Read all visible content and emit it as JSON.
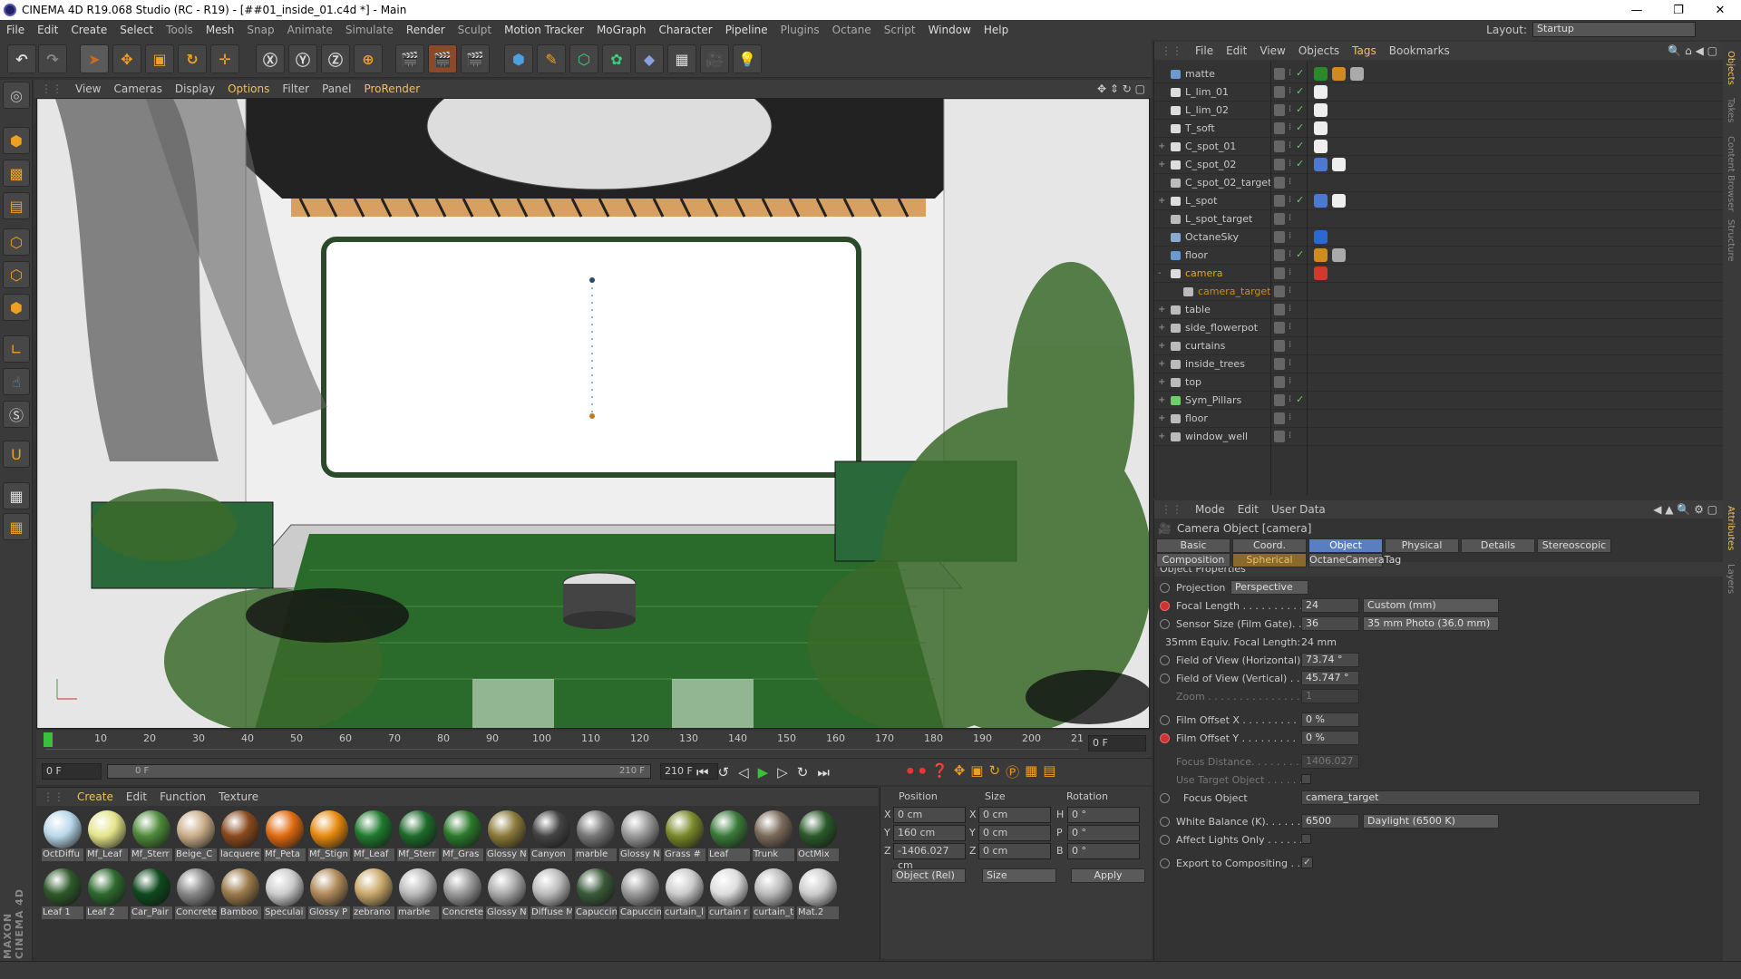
{
  "window": {
    "title": "CINEMA 4D R19.068 Studio (RC - R19) - [##01_inside_01.c4d *] - Main"
  },
  "menu": [
    "File",
    "Edit",
    "Create",
    "Select",
    "Tools",
    "Mesh",
    "Snap",
    "Animate",
    "Simulate",
    "Render",
    "Sculpt",
    "Motion Tracker",
    "MoGraph",
    "Character",
    "Pipeline",
    "Plugins",
    "Octane",
    "Script",
    "Window",
    "Help"
  ],
  "layout": {
    "label": "Layout:",
    "value": "Startup"
  },
  "viewport": {
    "menu": [
      "View",
      "Cameras",
      "Display",
      "Options",
      "Filter",
      "Panel",
      "ProRender"
    ]
  },
  "timeline": {
    "ticks": [
      "0",
      "10",
      "20",
      "30",
      "40",
      "50",
      "60",
      "70",
      "80",
      "90",
      "100",
      "110",
      "120",
      "130",
      "140",
      "150",
      "160",
      "170",
      "180",
      "190",
      "200",
      "21"
    ],
    "current_frame": "0 F",
    "start_field": "0 F",
    "slider_start": "0 F",
    "slider_end": "210 F",
    "end_field": "210 F"
  },
  "materials": {
    "menu": [
      "Create",
      "Edit",
      "Function",
      "Texture"
    ],
    "row1": [
      {
        "name": "OctDiffu",
        "color": "#b9d8ea"
      },
      {
        "name": "Mf_Leaf",
        "color": "#e4e48a"
      },
      {
        "name": "Mf_Sterr",
        "color": "#4e8a3a"
      },
      {
        "name": "Beige_C",
        "color": "#c9ad8a"
      },
      {
        "name": "lacquere",
        "color": "#8a4a1e"
      },
      {
        "name": "Mf_Peta",
        "color": "#e06a10"
      },
      {
        "name": "Mf_Stign",
        "color": "#e68a10"
      },
      {
        "name": "Mf_Leaf",
        "color": "#1f7a2e"
      },
      {
        "name": "Mf_Sterr",
        "color": "#1d6a2a"
      },
      {
        "name": "Mf_Gras",
        "color": "#2b7a2b"
      },
      {
        "name": "Glossy N",
        "color": "#8a7a3a"
      },
      {
        "name": "Canyon",
        "color": "#444"
      },
      {
        "name": "marble",
        "color": "#777"
      },
      {
        "name": "Glossy N",
        "color": "#999"
      },
      {
        "name": "Grass #",
        "color": "#7a8a2a"
      },
      {
        "name": "Leaf",
        "color": "#3a7a3a"
      },
      {
        "name": "Trunk",
        "color": "#7a6a5a"
      },
      {
        "name": "OctMix",
        "color": "#2a5a2a"
      }
    ],
    "row2": [
      {
        "name": "Leaf 1",
        "color": "#2e5a2a"
      },
      {
        "name": "Leaf 2",
        "color": "#2e6a2e"
      },
      {
        "name": "Car_Pair",
        "color": "#0e4a1e"
      },
      {
        "name": "Concrete",
        "color": "#888"
      },
      {
        "name": "Bamboo",
        "color": "#9a7a4a"
      },
      {
        "name": "Speculai",
        "color": "#ccc"
      },
      {
        "name": "Glossy P",
        "color": "#b08a5a"
      },
      {
        "name": "zebrano",
        "color": "#c9a86a"
      },
      {
        "name": "marble",
        "color": "#bbb"
      },
      {
        "name": "Concrete",
        "color": "#999"
      },
      {
        "name": "Glossy N",
        "color": "#aaa"
      },
      {
        "name": "Diffuse M",
        "color": "#bbb"
      },
      {
        "name": "Capuccin",
        "color": "#3a5a3a"
      },
      {
        "name": "Capuccin",
        "color": "#999"
      },
      {
        "name": "curtain_l",
        "color": "#ccc"
      },
      {
        "name": "curtain r",
        "color": "#ddd"
      },
      {
        "name": "curtain_t",
        "color": "#bbb"
      },
      {
        "name": "Mat.2",
        "color": "#ccc"
      }
    ]
  },
  "coords": {
    "headers": [
      "Position",
      "Size",
      "Rotation"
    ],
    "rows": [
      {
        "a": "X",
        "pos": "0 cm",
        "b": "X",
        "size": "0 cm",
        "c": "H",
        "rot": "0 °"
      },
      {
        "a": "Y",
        "pos": "160 cm",
        "b": "Y",
        "size": "0 cm",
        "c": "P",
        "rot": "0 °"
      },
      {
        "a": "Z",
        "pos": "-1406.027 cm",
        "b": "Z",
        "size": "0 cm",
        "c": "B",
        "rot": "0 °"
      }
    ],
    "mode": "Object (Rel)",
    "size_mode": "Size",
    "apply": "Apply"
  },
  "objects": {
    "menu": [
      "File",
      "Edit",
      "View",
      "Objects",
      "Tags",
      "Bookmarks"
    ],
    "items": [
      {
        "name": "matte",
        "expand": "",
        "icon": "#6a9ad0",
        "check": true,
        "tags": [
          "#2a8a2a",
          "#d08a20",
          "#aaa"
        ]
      },
      {
        "name": "L_lim_01",
        "expand": "",
        "icon": "#ddd",
        "check": true,
        "tags": [
          "#eee"
        ]
      },
      {
        "name": "L_lim_02",
        "expand": "",
        "icon": "#ddd",
        "check": true,
        "tags": [
          "#eee"
        ]
      },
      {
        "name": "T_soft",
        "expand": "",
        "icon": "#ddd",
        "check": true,
        "tags": [
          "#eee"
        ]
      },
      {
        "name": "C_spot_01",
        "expand": "+",
        "icon": "#ddd",
        "check": true,
        "tags": [
          "#eee"
        ]
      },
      {
        "name": "C_spot_02",
        "expand": "+",
        "icon": "#ddd",
        "check": true,
        "tags": [
          "#4a7ad0",
          "#eee"
        ]
      },
      {
        "name": "C_spot_02_target",
        "expand": "",
        "icon": "#bbb",
        "check": false,
        "tags": []
      },
      {
        "name": "L_spot",
        "expand": "+",
        "icon": "#ddd",
        "check": true,
        "tags": [
          "#4a7ad0",
          "#eee"
        ]
      },
      {
        "name": "L_spot_target",
        "expand": "",
        "icon": "#bbb",
        "check": false,
        "tags": []
      },
      {
        "name": "OctaneSky",
        "expand": "",
        "icon": "#8aaad0",
        "check": false,
        "tags": [
          "#2a6ad0"
        ]
      },
      {
        "name": "floor",
        "expand": "",
        "icon": "#6a9ad0",
        "check": true,
        "tags": [
          "#d08a20",
          "#aaa"
        ]
      },
      {
        "name": "camera",
        "expand": "-",
        "icon": "#ddd",
        "check": false,
        "selected": true,
        "tags": [
          "#d03a2a"
        ]
      },
      {
        "name": "camera_target",
        "expand": "",
        "icon": "#bbb",
        "check": false,
        "child": true,
        "tags": []
      },
      {
        "name": "table",
        "expand": "+",
        "icon": "#bbb",
        "check": false,
        "tags": []
      },
      {
        "name": "side_flowerpot",
        "expand": "+",
        "icon": "#bbb",
        "check": false,
        "tags": []
      },
      {
        "name": "curtains",
        "expand": "+",
        "icon": "#bbb",
        "check": false,
        "tags": []
      },
      {
        "name": "inside_trees",
        "expand": "+",
        "icon": "#bbb",
        "check": false,
        "tags": []
      },
      {
        "name": "top",
        "expand": "+",
        "icon": "#bbb",
        "check": false,
        "tags": []
      },
      {
        "name": "Sym_Pillars",
        "expand": "+",
        "icon": "#6ad06a",
        "check": true,
        "tags": []
      },
      {
        "name": "floor",
        "expand": "+",
        "icon": "#bbb",
        "check": false,
        "tags": []
      },
      {
        "name": "window_well",
        "expand": "+",
        "icon": "#bbb",
        "check": false,
        "tags": []
      }
    ]
  },
  "attributes": {
    "menu": [
      "Mode",
      "Edit",
      "User Data"
    ],
    "header": "Camera Object [camera]",
    "tabs_row1": [
      "Basic",
      "Coord.",
      "Object",
      "Physical",
      "Details",
      "Stereoscopic"
    ],
    "tabs_row2": [
      "Composition",
      "Spherical",
      "OctaneCameraTag"
    ],
    "section": "Object Properties",
    "projection_label": "Projection",
    "projection_value": "Perspective",
    "focal_label": "Focal Length . . . . . . . . . .",
    "focal_value": "24",
    "focal_preset": "Custom (mm)",
    "sensor_label": "Sensor Size (Film Gate). .",
    "sensor_value": "36",
    "sensor_preset": "35 mm Photo (36.0 mm)",
    "equiv_label": "35mm Equiv. Focal Length:",
    "equiv_value": "24 mm",
    "fovh_label": "Field of View (Horizontal)",
    "fovh_value": "73.74 °",
    "fovv_label": "Field of View (Vertical) . .",
    "fovv_value": "45.747 °",
    "zoom_label": "Zoom . . . . . . . . . . . . . . . .",
    "zoom_value": "1",
    "offx_label": "Film Offset X . . . . . . . . .",
    "offx_value": "0 %",
    "offy_label": "Film Offset Y . . . . . . . . .",
    "offy_value": "0 %",
    "focusdist_label": "Focus Distance. . . . . . . . .",
    "focusdist_value": "1406.027",
    "usetarget_label": "Use Target Object . . . . . .",
    "focusobj_label": "Focus Object",
    "focusobj_value": "camera_target",
    "wb_label": "White Balance (K). . . . . .",
    "wb_value": "6500",
    "wb_preset": "Daylight (6500 K)",
    "affect_label": "Affect Lights Only . . . . . .",
    "export_label": "Export to Compositing . . . .",
    "export_check": "✓"
  },
  "side_tabs": [
    "Objects",
    "Takes",
    "Content Browser",
    "Structure",
    "Attributes",
    "Layers"
  ],
  "brand": "MAXON CINEMA 4D"
}
